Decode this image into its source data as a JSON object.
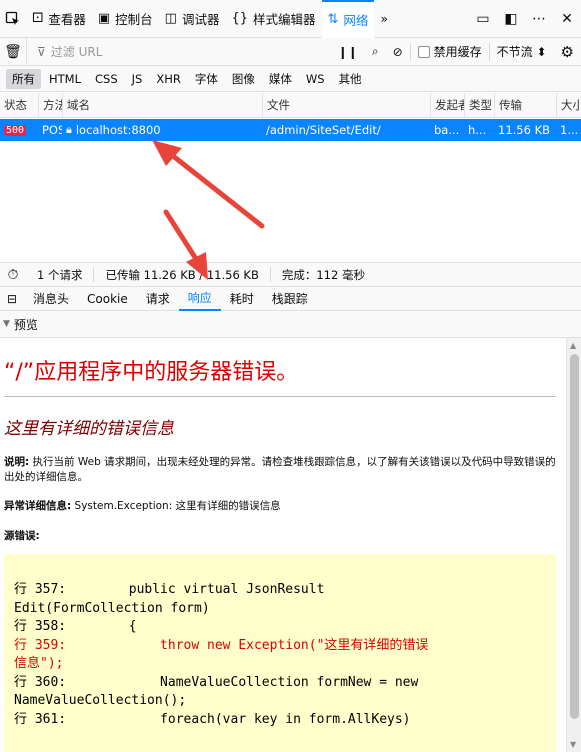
{
  "toolbar": {
    "tabs": [
      {
        "label": "查看器",
        "icon": "inspector-icon"
      },
      {
        "label": "控制台",
        "icon": "console-icon"
      },
      {
        "label": "调试器",
        "icon": "debugger-icon"
      },
      {
        "label": "样式编辑器",
        "icon": "style-editor-icon"
      },
      {
        "label": "网络",
        "icon": "network-icon"
      }
    ],
    "more_label": "»"
  },
  "filterbar": {
    "placeholder": "过滤 URL",
    "disable_cache_label": "禁用缓存",
    "throttle_label": "不节流 ⬍"
  },
  "type_filters": [
    "所有",
    "HTML",
    "CSS",
    "JS",
    "XHR",
    "字体",
    "图像",
    "媒体",
    "WS",
    "其他"
  ],
  "table": {
    "headers": [
      "状态",
      "方法",
      "域名",
      "文件",
      "发起者",
      "类型",
      "传输",
      "大小"
    ],
    "rows": [
      {
        "status": "500",
        "method": "POST",
        "domain": "localhost:8800",
        "file": "/admin/SiteSet/Edit/",
        "cause": "ba...",
        "type": "h...",
        "transferred": "11.56 KB",
        "size": "1..."
      }
    ]
  },
  "summary": {
    "requests": "1 个请求",
    "transferred": "已传输 11.26 KB / 11.56 KB",
    "finish": "完成：112 毫秒"
  },
  "detail_tabs": [
    "消息头",
    "Cookie",
    "请求",
    "响应",
    "耗时",
    "栈跟踪"
  ],
  "preview": {
    "label": "预览",
    "title": "“/”应用程序中的服务器错误。",
    "subtitle": "这里有详细的错误信息",
    "desc_label": "说明:",
    "desc_text": " 执行当前 Web 请求期间，出现未经处理的异常。请检查堆栈跟踪信息，以了解有关该错误以及代码中导致错误的出处的详细信息。",
    "exception_label": "异常详细信息:",
    "exception_text": " System.Exception: 这里有详细的错误信息",
    "source_error_label": "源错误:",
    "code_lines": [
      {
        "text": "行 357:        public virtual JsonResult",
        "red": false
      },
      {
        "text": "Edit(FormCollection form)",
        "red": false
      },
      {
        "text": "行 358:        {",
        "red": false
      },
      {
        "text": "行 359:            throw new Exception(\"这里有详细的错误",
        "red": true
      },
      {
        "text": "信息\");",
        "red": true
      },
      {
        "text": "行 360:            NameValueCollection formNew = new",
        "red": false
      },
      {
        "text": "NameValueCollection();",
        "red": false
      },
      {
        "text": "行 361:            foreach(var key in form.AllKeys)",
        "red": false
      }
    ]
  },
  "colors": {
    "accent": "#0a84ff",
    "error_status": "#e22850",
    "error_title": "#dd0000",
    "annotation_arrow": "#e8443a"
  }
}
